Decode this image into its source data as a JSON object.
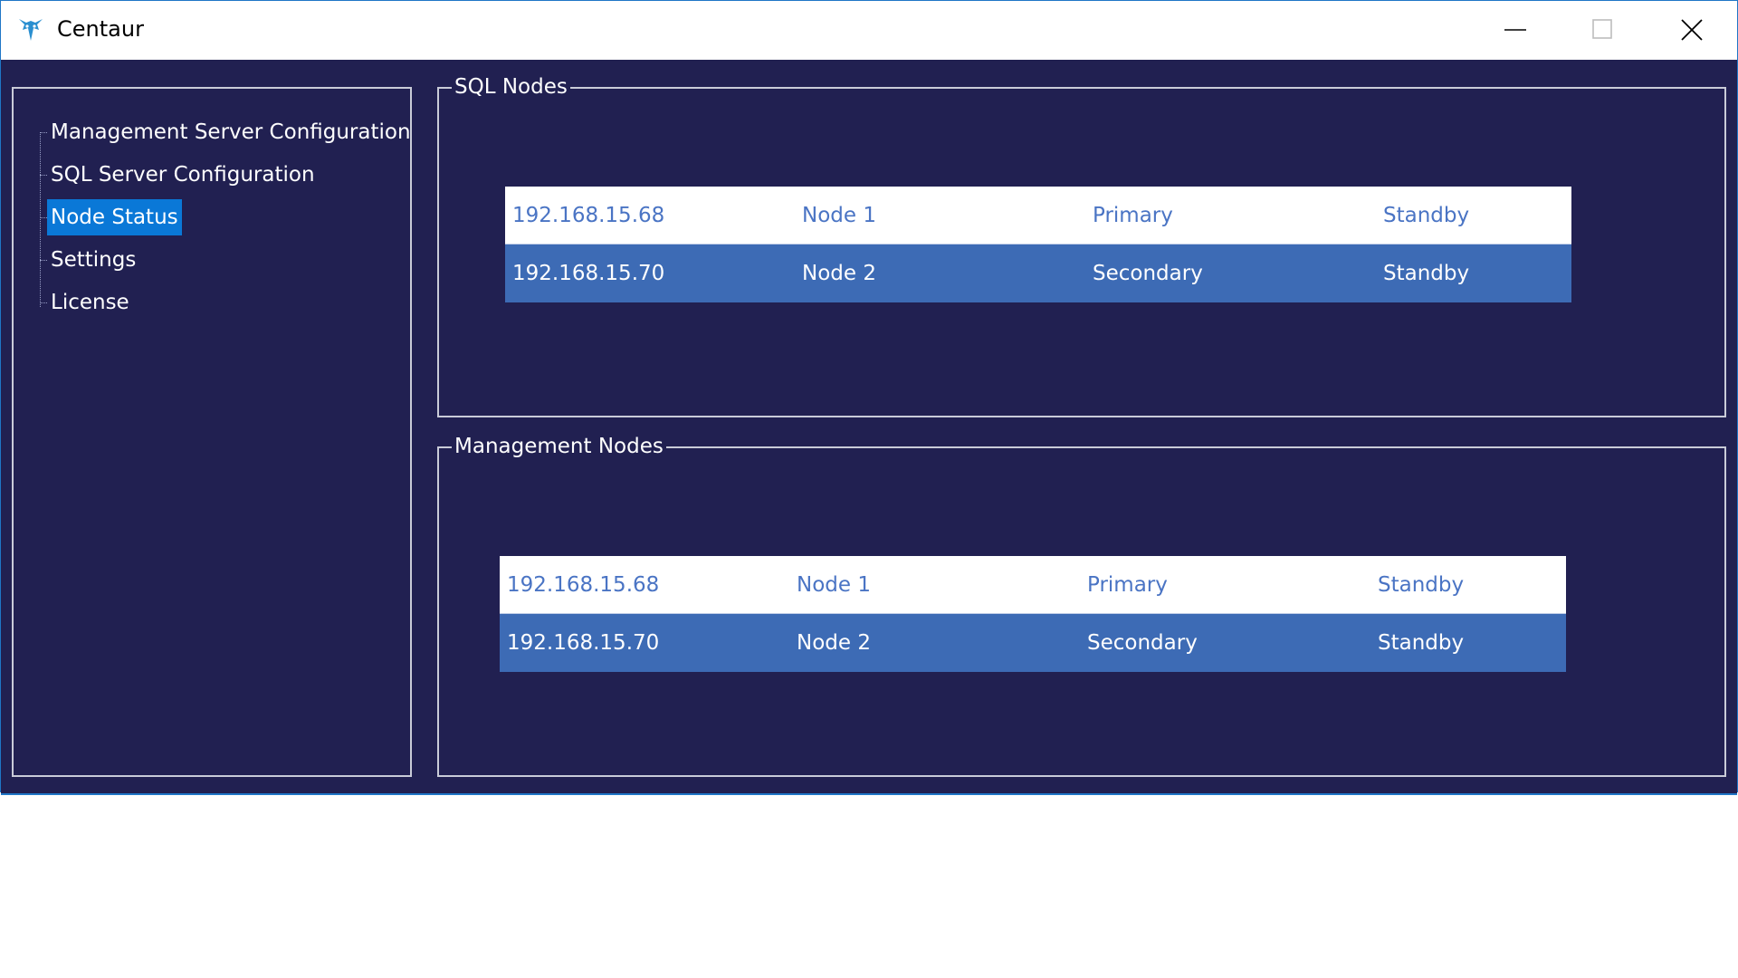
{
  "window": {
    "title": "Centaur",
    "controls": {
      "minimize": "minimize",
      "maximize": "maximize",
      "close": "close"
    }
  },
  "nav": {
    "items": [
      {
        "label": "Management Server Configuration",
        "selected": false
      },
      {
        "label": "SQL Server Configuration",
        "selected": false
      },
      {
        "label": "Node Status",
        "selected": true
      },
      {
        "label": "Settings",
        "selected": false
      },
      {
        "label": "License",
        "selected": false
      }
    ]
  },
  "sql_nodes": {
    "title": "SQL Nodes",
    "rows": [
      {
        "ip": "192.168.15.68",
        "node": "Node 1",
        "role": "Primary",
        "status": "Standby"
      },
      {
        "ip": "192.168.15.70",
        "node": "Node 2",
        "role": "Secondary",
        "status": "Standby"
      }
    ]
  },
  "management_nodes": {
    "title": "Management Nodes",
    "rows": [
      {
        "ip": "192.168.15.68",
        "node": "Node 1",
        "role": "Primary",
        "status": "Standby"
      },
      {
        "ip": "192.168.15.70",
        "node": "Node 2",
        "role": "Secondary",
        "status": "Standby"
      }
    ]
  },
  "colors": {
    "background": "#212051",
    "selection": "#0a78d7",
    "row_selected": "#3d6bb5",
    "row_text": "#4a74c4"
  }
}
